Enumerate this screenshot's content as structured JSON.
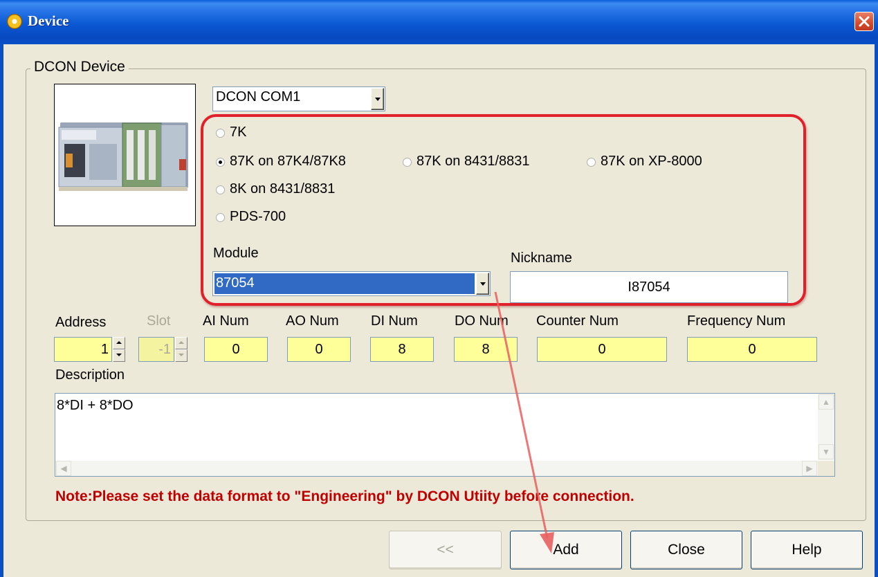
{
  "window": {
    "title": "Device"
  },
  "group": {
    "title": "DCON Device"
  },
  "com_select": {
    "value": "DCON COM1"
  },
  "radios": [
    {
      "label": "7K",
      "checked": false
    },
    {
      "label": "87K on 87K4/87K8",
      "checked": true
    },
    {
      "label": "87K on 8431/8831",
      "checked": false
    },
    {
      "label": "87K on XP-8000",
      "checked": false
    },
    {
      "label": "8K on 8431/8831",
      "checked": false
    },
    {
      "label": "PDS-700",
      "checked": false
    }
  ],
  "module": {
    "label": "Module",
    "value": "87054"
  },
  "nickname": {
    "label": "Nickname",
    "value": "I87054"
  },
  "fields": {
    "address": {
      "label": "Address",
      "value": "1"
    },
    "slot": {
      "label": "Slot",
      "value": "-1"
    },
    "ai": {
      "label": "AI Num",
      "value": "0"
    },
    "ao": {
      "label": "AO Num",
      "value": "0"
    },
    "di": {
      "label": "DI Num",
      "value": "8"
    },
    "do": {
      "label": "DO Num",
      "value": "8"
    },
    "counter": {
      "label": "Counter Num",
      "value": "0"
    },
    "frequency": {
      "label": "Frequency Num",
      "value": "0"
    }
  },
  "description": {
    "label": "Description",
    "value": "8*DI + 8*DO"
  },
  "note": "Note:Please set the data format to \"Engineering\" by DCON Utiity before connection.",
  "buttons": {
    "back": "<<",
    "add": "Add",
    "close": "Close",
    "help": "Help"
  },
  "colors": {
    "highlight": "#E0202A",
    "note": "#C00000",
    "field_bg": "#FFFF99",
    "selection": "#316AC5"
  }
}
